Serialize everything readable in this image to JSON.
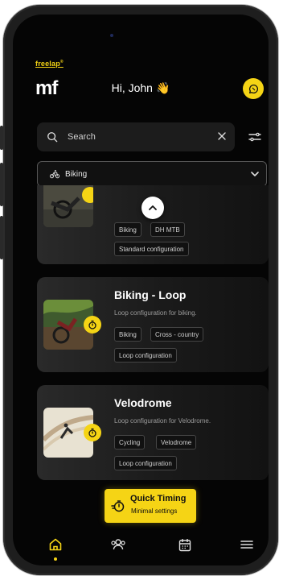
{
  "header": {
    "brand_small": "freelap",
    "brand_small_sup": "®",
    "brand_logo": "mf",
    "greeting": "Hi, John",
    "greeting_emoji": "👋",
    "chat_icon": "chat-bubble-icon"
  },
  "search": {
    "placeholder": "Search",
    "value": ""
  },
  "filter": {
    "selected": "Biking"
  },
  "cards": [
    {
      "title": "",
      "description": "",
      "tags": [
        "Biking",
        "DH MTB",
        "Standard configuration"
      ]
    },
    {
      "title": "Biking - Loop",
      "description": "Loop configuration for biking.",
      "tags": [
        "Biking",
        "Cross - country",
        "Loop configuration"
      ]
    },
    {
      "title": "Velodrome",
      "description": "Loop configuration for Velodrome.",
      "tags": [
        "Cycling",
        "Velodrome",
        "Loop configuration"
      ]
    }
  ],
  "quick_timing": {
    "title": "Quick Timing",
    "subtitle": "Minimal settings"
  },
  "nav": {
    "items": [
      "home-icon",
      "users-icon",
      "calendar-icon",
      "menu-icon"
    ],
    "active": "home-icon"
  },
  "colors": {
    "accent": "#f5d415",
    "background": "#050505",
    "card": "#1e1e1e"
  }
}
